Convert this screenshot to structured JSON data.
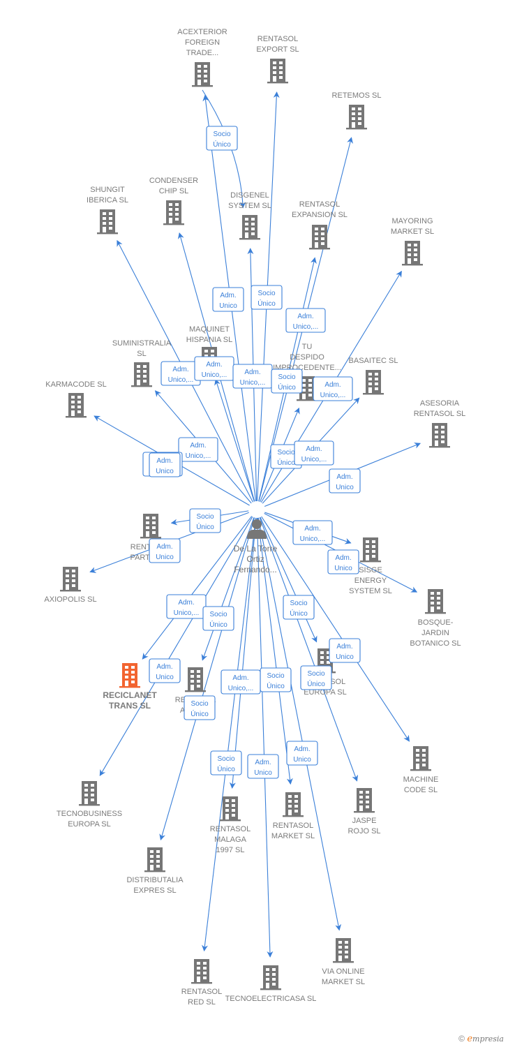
{
  "colors": {
    "edge": "#3a7fd8",
    "building": "#767676",
    "building_highlight": "#f26430",
    "label": "#7b7b7b"
  },
  "center": {
    "name_lines": [
      "De La Torre",
      "Ortiz",
      "Fernando..."
    ],
    "icon": "person-icon"
  },
  "companies": [
    {
      "id": "acexterior",
      "lines": [
        "ACEXTERIOR",
        "FOREIGN",
        "TRADE..."
      ]
    },
    {
      "id": "rentasol-export",
      "lines": [
        "RENTASOL",
        "EXPORT  SL"
      ]
    },
    {
      "id": "retemos",
      "lines": [
        "RETEMOS  SL"
      ]
    },
    {
      "id": "shungit",
      "lines": [
        "SHUNGIT",
        "IBERICA  SL"
      ]
    },
    {
      "id": "condenser",
      "lines": [
        "CONDENSER",
        "CHIP SL"
      ]
    },
    {
      "id": "disgenel",
      "lines": [
        "DISGENEL",
        "SYSTEM  SL"
      ]
    },
    {
      "id": "rentasol-expansion",
      "lines": [
        "RENTASOL",
        "EXPANSION  SL"
      ]
    },
    {
      "id": "mayoring",
      "lines": [
        "MAYORING",
        "MARKET  SL"
      ]
    },
    {
      "id": "maquinet",
      "lines": [
        "MAQUINET",
        "HISPANIA  SL"
      ]
    },
    {
      "id": "suministralia",
      "lines": [
        "SUMINISTRALIA",
        "SL"
      ]
    },
    {
      "id": "tu-despido",
      "lines": [
        "TU",
        "DESPIDO",
        "IMPROCEDENTE..."
      ]
    },
    {
      "id": "basaitec",
      "lines": [
        "BASAITEC  SL"
      ]
    },
    {
      "id": "karmacode",
      "lines": [
        "KARMACODE SL"
      ]
    },
    {
      "id": "asesoria",
      "lines": [
        "ASESORIA",
        "RENTASOL SL"
      ]
    },
    {
      "id": "rentasol-partners",
      "lines": [
        "RENTASOL",
        "PARTNERS"
      ]
    },
    {
      "id": "axiopolis",
      "lines": [
        "AXIOPOLIS SL"
      ]
    },
    {
      "id": "sisge",
      "lines": [
        "SISGE",
        "ENERGY",
        "SYSTEM  SL"
      ]
    },
    {
      "id": "bosque",
      "lines": [
        "BOSQUE-",
        "JARDIN",
        "BOTANICO SL"
      ]
    },
    {
      "id": "reciclanet",
      "lines": [
        "RECICLANET",
        "TRANS  SL"
      ],
      "highlight": true
    },
    {
      "id": "rentasol-azul",
      "lines": [
        "RENTASOL",
        "AZUL  SL"
      ]
    },
    {
      "id": "rentasol-europa",
      "lines": [
        "RENTASOL",
        "EUROPA  SL"
      ]
    },
    {
      "id": "machine-code",
      "lines": [
        "MACHINE",
        "CODE SL"
      ]
    },
    {
      "id": "tecnobusiness",
      "lines": [
        "TECNOBUSINESS",
        "EUROPA SL"
      ]
    },
    {
      "id": "rentasol-malaga",
      "lines": [
        "RENTASOL",
        "MALAGA",
        "1997  SL"
      ]
    },
    {
      "id": "rentasol-market",
      "lines": [
        "RENTASOL",
        "MARKET  SL"
      ]
    },
    {
      "id": "jaspe",
      "lines": [
        "JASPE",
        "ROJO  SL"
      ]
    },
    {
      "id": "distributalia",
      "lines": [
        "DISTRIBUTALIA",
        "EXPRES  SL"
      ]
    },
    {
      "id": "rentasol-red",
      "lines": [
        "RENTASOL",
        "RED  SL"
      ]
    },
    {
      "id": "tecnoelectricasa",
      "lines": [
        "TECNOELECTRICASA SL"
      ]
    },
    {
      "id": "via-online",
      "lines": [
        "VIA ONLINE",
        "MARKET SL"
      ]
    }
  ],
  "relations": [
    {
      "target": "acexterior",
      "label": [
        "Adm.",
        "Unico"
      ]
    },
    {
      "target": "disgenel",
      "label": [
        "Socio",
        "Único"
      ],
      "via": "acexterior"
    },
    {
      "target": "rentasol-export",
      "label": [
        "Socio",
        "Único"
      ]
    },
    {
      "target": "retemos",
      "label": [
        "Adm.",
        "Unico,..."
      ]
    },
    {
      "target": "shungit",
      "label": [
        "Adm.",
        "Unico,..."
      ]
    },
    {
      "target": "condenser",
      "label": [
        "Adm.",
        "Unico,..."
      ]
    },
    {
      "target": "disgenel",
      "label": [
        "Adm.",
        "Unico,..."
      ]
    },
    {
      "target": "rentasol-expansion",
      "label": [
        "Socio",
        "Único"
      ]
    },
    {
      "target": "mayoring",
      "label": [
        "Adm.",
        "Unico,..."
      ]
    },
    {
      "target": "maquinet",
      "label": [
        "Adm.",
        "Unico,..."
      ]
    },
    {
      "target": "suministralia",
      "label": [
        "Adm.",
        "Unico,..."
      ]
    },
    {
      "target": "tu-despido",
      "label": [
        "Socio",
        "Único"
      ]
    },
    {
      "target": "basaitec",
      "label": [
        "Adm.",
        "Unico,..."
      ]
    },
    {
      "target": "karmacode",
      "label": [
        "Adm.",
        "Unico"
      ]
    },
    {
      "target": "asesoria",
      "label": [
        "Adm.",
        "Unico"
      ]
    },
    {
      "target": "rentasol-partners",
      "label": [
        "Socio",
        "Único"
      ]
    },
    {
      "target": "axiopolis",
      "label": [
        "Adm.",
        "Unico"
      ]
    },
    {
      "target": "sisge",
      "label": [
        "Adm.",
        "Unico,..."
      ]
    },
    {
      "target": "bosque",
      "label": [
        "Adm.",
        "Unico"
      ]
    },
    {
      "target": "reciclanet",
      "label": [
        "Adm.",
        "Unico,..."
      ]
    },
    {
      "target": "rentasol-azul",
      "label": [
        "Socio",
        "Único"
      ]
    },
    {
      "target": "rentasol-europa",
      "label": [
        "Socio",
        "Único"
      ]
    },
    {
      "target": "machine-code",
      "label": [
        "Adm.",
        "Unico"
      ]
    },
    {
      "target": "tecnobusiness",
      "label": [
        "Adm.",
        "Unico"
      ]
    },
    {
      "target": "rentasol-malaga",
      "label": [
        "Socio",
        "Único"
      ]
    },
    {
      "target": "rentasol-market",
      "label": [
        "Adm.",
        "Unico"
      ]
    },
    {
      "target": "jaspe",
      "label": [
        "Socio",
        "Único"
      ]
    },
    {
      "target": "distributalia",
      "label": [
        "Socio",
        "Único"
      ]
    },
    {
      "target": "rentasol-red",
      "label": [
        "Adm.",
        "Unico,..."
      ]
    },
    {
      "target": "tecnoelectricasa",
      "label": [
        "Adm.",
        "Unico"
      ]
    },
    {
      "target": "via-online",
      "label": [
        "Socio",
        "Único"
      ]
    }
  ],
  "footer": {
    "copyright": "©",
    "brand_initial": "e",
    "brand_rest": "mpresia"
  }
}
